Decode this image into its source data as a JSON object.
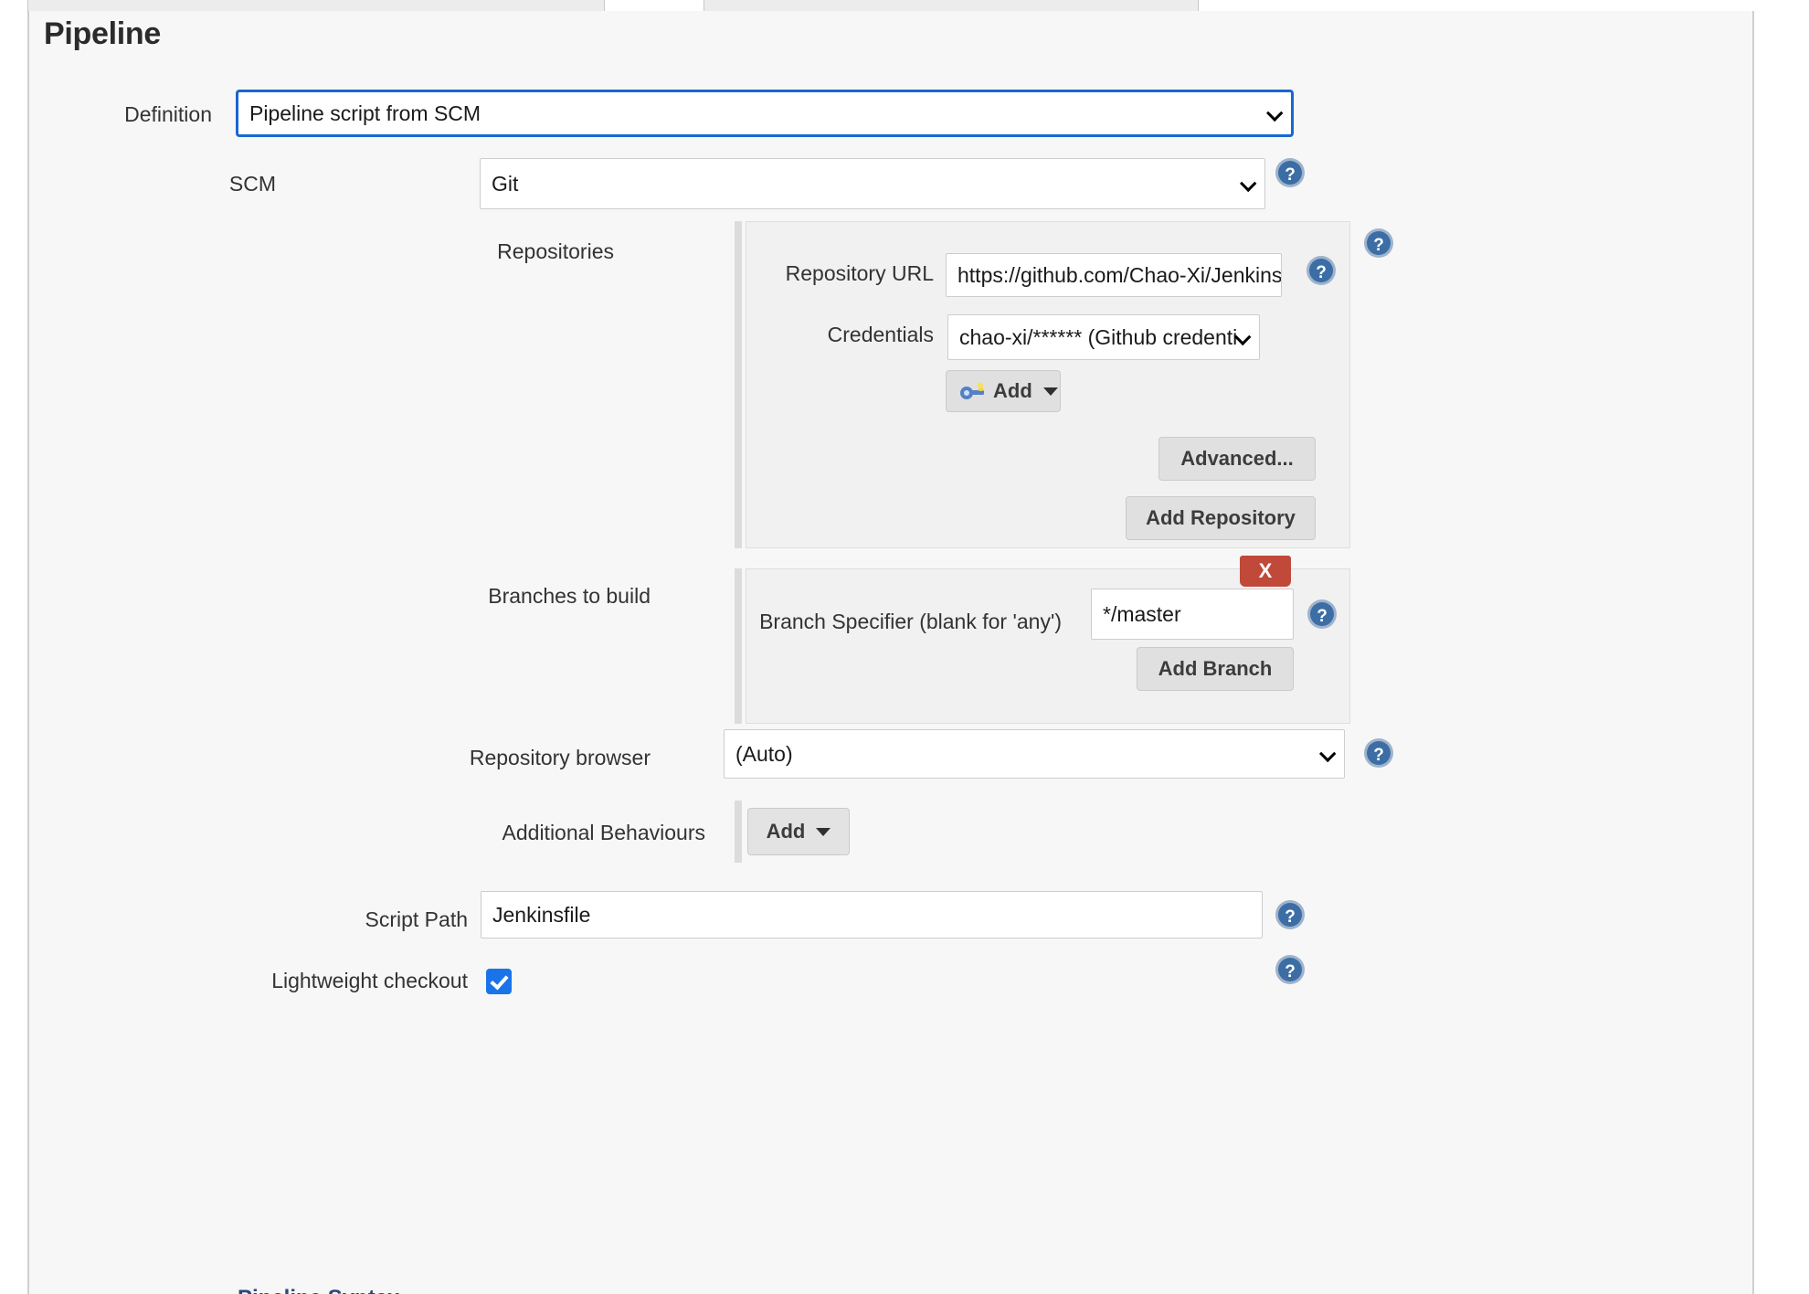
{
  "page": {
    "title": "Pipeline"
  },
  "tabs": {
    "tab_one": "",
    "tab_two": ""
  },
  "definition": {
    "label": "Definition",
    "value": "Pipeline script from SCM"
  },
  "scm": {
    "label": "SCM",
    "value": "Git",
    "help_icon": "help-icon"
  },
  "repositories": {
    "label": "Repositories",
    "help_icon": "help-icon",
    "repository_url": {
      "label": "Repository URL",
      "value": "https://github.com/Chao-Xi/Jenkinslib",
      "help_icon": "help-icon"
    },
    "credentials": {
      "label": "Credentials",
      "value": "chao-xi/****** (Github credenti",
      "add_button": "Add",
      "add_icon": "key-icon",
      "caret_icon": "caret-down-icon"
    },
    "advanced_button": "Advanced...",
    "add_repository_button": "Add Repository"
  },
  "branches": {
    "label": "Branches to build",
    "delete_button": "X",
    "branch_specifier": {
      "label": "Branch Specifier (blank for 'any')",
      "value": "*/master",
      "help_icon": "help-icon"
    },
    "add_branch_button": "Add Branch"
  },
  "repository_browser": {
    "label": "Repository browser",
    "value": "(Auto)",
    "help_icon": "help-icon"
  },
  "additional_behaviours": {
    "label": "Additional Behaviours",
    "add_button": "Add",
    "caret_icon": "caret-down-icon"
  },
  "script_path": {
    "label": "Script Path",
    "value": "Jenkinsfile",
    "help_icon": "help-icon"
  },
  "lightweight_checkout": {
    "label": "Lightweight checkout",
    "checked": true,
    "help_icon": "help-icon"
  },
  "footer": {
    "pipeline_syntax_link": "Pipeline Syntax"
  },
  "colors": {
    "focus_blue": "#1967d2",
    "checkbox_blue": "#1a73e8",
    "delete_red": "#c0493a",
    "panel_bg": "#f1f1f1",
    "page_bg": "#f7f7f7",
    "link_blue": "#29487d"
  }
}
